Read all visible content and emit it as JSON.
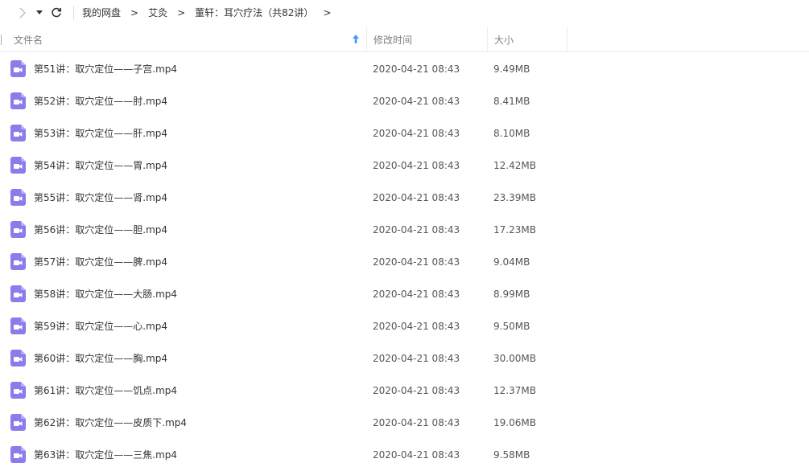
{
  "toolbar": {
    "back_icon": "chevron-left-icon",
    "dropdown_icon": "caret-down-icon",
    "refresh_icon": "refresh-icon"
  },
  "breadcrumb": {
    "items": [
      "我的网盘",
      "艾灸",
      "董轩：耳穴疗法（共82讲）"
    ],
    "separator": ">"
  },
  "columns": {
    "name": "文件名",
    "date": "修改时间",
    "size": "大小"
  },
  "colors": {
    "icon_purple": "#8a7cea",
    "sort_arrow": "#3d9bf0"
  },
  "files": [
    {
      "name": "第51讲：取穴定位——子宫.mp4",
      "date": "2020-04-21 08:43",
      "size": "9.49MB"
    },
    {
      "name": "第52讲：取穴定位——肘.mp4",
      "date": "2020-04-21 08:43",
      "size": "8.41MB"
    },
    {
      "name": "第53讲：取穴定位——肝.mp4",
      "date": "2020-04-21 08:43",
      "size": "8.10MB"
    },
    {
      "name": "第54讲：取穴定位——胃.mp4",
      "date": "2020-04-21 08:43",
      "size": "12.42MB"
    },
    {
      "name": "第55讲：取穴定位——肾.mp4",
      "date": "2020-04-21 08:43",
      "size": "23.39MB"
    },
    {
      "name": "第56讲：取穴定位——胆.mp4",
      "date": "2020-04-21 08:43",
      "size": "17.23MB"
    },
    {
      "name": "第57讲：取穴定位——脾.mp4",
      "date": "2020-04-21 08:43",
      "size": "9.04MB"
    },
    {
      "name": "第58讲：取穴定位——大肠.mp4",
      "date": "2020-04-21 08:43",
      "size": "8.99MB"
    },
    {
      "name": "第59讲：取穴定位——心.mp4",
      "date": "2020-04-21 08:43",
      "size": "9.50MB"
    },
    {
      "name": "第60讲：取穴定位——胸.mp4",
      "date": "2020-04-21 08:43",
      "size": "30.00MB"
    },
    {
      "name": "第61讲：取穴定位——饥点.mp4",
      "date": "2020-04-21 08:43",
      "size": "12.37MB"
    },
    {
      "name": "第62讲：取穴定位——皮质下.mp4",
      "date": "2020-04-21 08:43",
      "size": "19.06MB"
    },
    {
      "name": "第63讲：取穴定位——三焦.mp4",
      "date": "2020-04-21 08:43",
      "size": "9.58MB"
    }
  ]
}
